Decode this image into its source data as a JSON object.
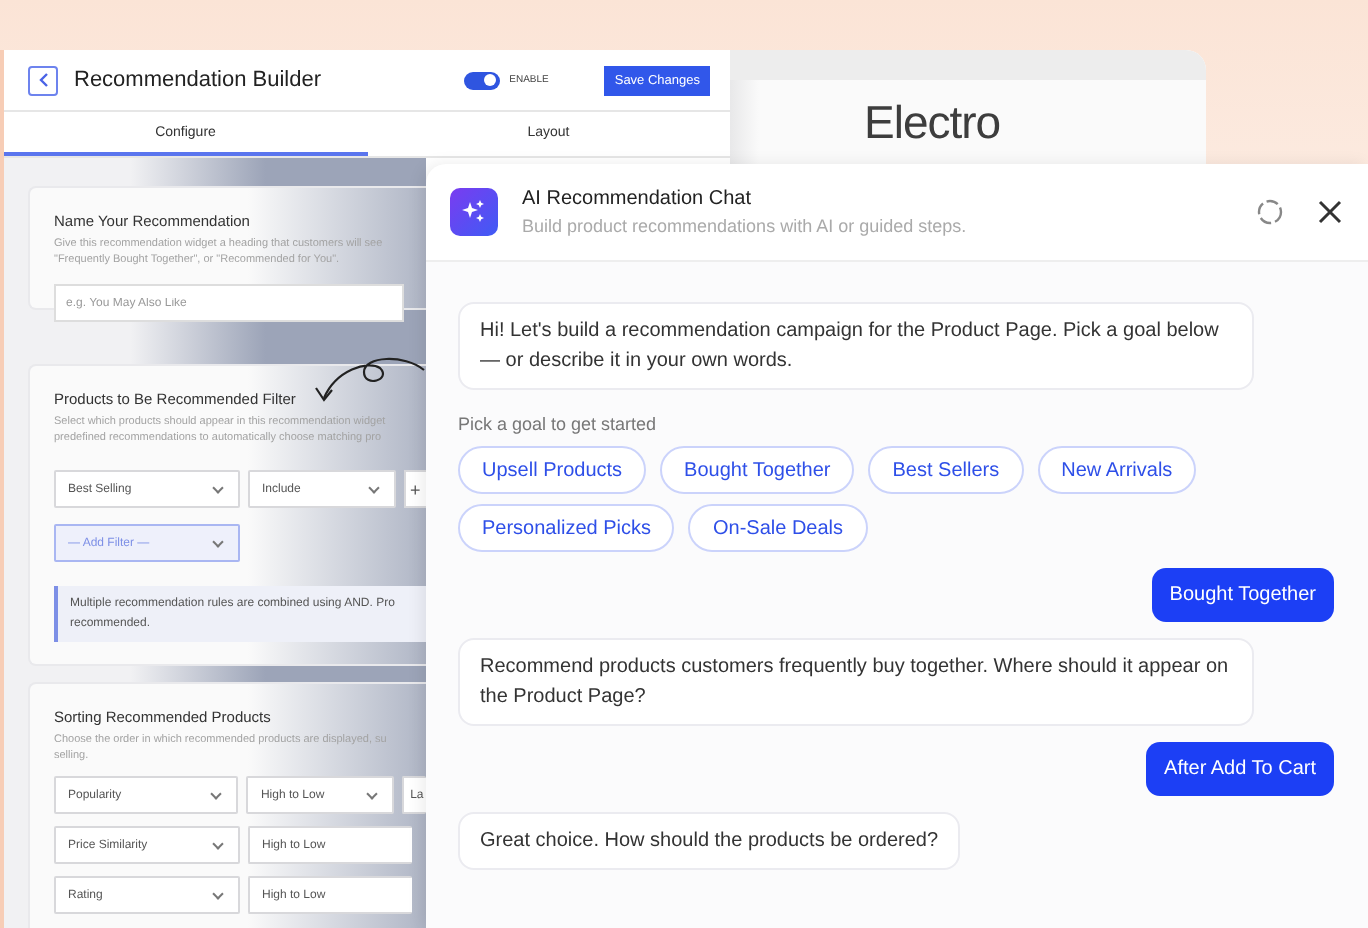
{
  "builder": {
    "title": "Recommendation Builder",
    "enable_toggle": {
      "label": "ENABLE",
      "on": true
    },
    "save_button": "Save Changes",
    "tabs": [
      {
        "label": "Configure",
        "selected": true
      },
      {
        "label": "Layout",
        "selected": false
      }
    ],
    "name_section": {
      "title": "Name Your Recommendation",
      "description": [
        "Give this recommendation widget a heading that customers will see",
        "\"Frequently Bought Together\", or \"Recommended for You\"."
      ],
      "placeholder": "e.g. You May Also Like"
    },
    "filter_section": {
      "title": "Products to Be Recommended Filter",
      "description": [
        "Select which products should appear in this recommendation widget",
        "predefined recommendations to automatically choose matching pro"
      ],
      "selects": [
        "Best Selling",
        "Include"
      ],
      "add_button": "+",
      "add_filter": "— Add Filter —",
      "note": "Multiple recommendation rules are combined using AND. Pro recommended."
    },
    "sorting_section": {
      "title": "Sorting Recommended Products",
      "description": [
        "Choose the order in which recommended products are displayed, su",
        "selling."
      ],
      "rows": [
        [
          {
            "kind": "dropdown",
            "value": "Popularity"
          },
          {
            "kind": "dropdown",
            "value": "High to Low"
          },
          {
            "kind": "cut",
            "value": "La"
          }
        ],
        [
          {
            "kind": "dropdown",
            "value": "Price Similarity"
          },
          {
            "kind": "wide",
            "value": "High to Low"
          }
        ],
        [
          {
            "kind": "dropdown",
            "value": "Rating"
          },
          {
            "kind": "wide",
            "value": "High to Low"
          }
        ]
      ]
    }
  },
  "storefront": {
    "logo": "Electro"
  },
  "chat": {
    "title": "AI Recommendation Chat",
    "subtitle": "Build product recommendations with AI or guided steps.",
    "messages": [
      {
        "kind": "bot",
        "text": "Hi! Let's build a recommendation campaign for the Product Page. Pick a goal below — or describe it in your own words."
      },
      {
        "kind": "chips",
        "label": "Pick a goal to get started",
        "options": [
          "Upsell Products",
          "Bought Together",
          "Best Sellers",
          "New Arrivals",
          "Personalized Picks",
          "On-Sale Deals"
        ]
      },
      {
        "kind": "user",
        "text": "Bought Together"
      },
      {
        "kind": "bot",
        "text": "Recommend products customers frequently buy together. Where should it appear on the Product Page?"
      },
      {
        "kind": "user",
        "text": "After Add To Cart"
      },
      {
        "kind": "bot",
        "text": "Great choice. How should the products be ordered?"
      }
    ]
  }
}
